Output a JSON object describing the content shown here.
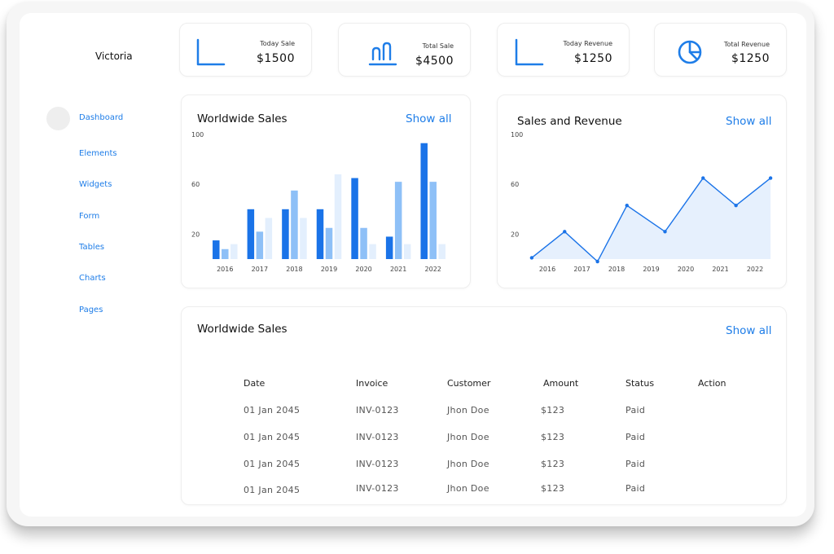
{
  "sidebar": {
    "brand": "Victoria",
    "items": [
      {
        "label": "Dashboard"
      },
      {
        "label": "Elements"
      },
      {
        "label": "Widgets"
      },
      {
        "label": "Form"
      },
      {
        "label": "Tables"
      },
      {
        "label": "Charts"
      },
      {
        "label": "Pages"
      }
    ]
  },
  "stats": [
    {
      "label": "Today Sale",
      "value": "$1500",
      "icon": "line-chart-icon"
    },
    {
      "label": "Total Sale",
      "value": "$4500",
      "icon": "bar-chart-icon"
    },
    {
      "label": "Today Revenue",
      "value": "$1250",
      "icon": "area-chart-icon"
    },
    {
      "label": "Total Revenue",
      "value": "$1250",
      "icon": "pie-chart-icon"
    }
  ],
  "worldwide_sales_chart": {
    "title": "Worldwide Sales",
    "show_all": "Show all"
  },
  "sales_revenue_chart": {
    "title": "Sales and Revenue",
    "show_all": "Show all"
  },
  "sales_table": {
    "title": "Worldwide Sales",
    "show_all": "Show all",
    "columns": [
      "Date",
      "Invoice",
      "Customer",
      "Amount",
      "Status",
      "Action"
    ],
    "rows": [
      {
        "date": "01 Jan 2045",
        "invoice": "INV-0123",
        "customer": "Jhon Doe",
        "amount": "$123",
        "status": "Paid"
      },
      {
        "date": "01 Jan 2045",
        "invoice": "INV-0123",
        "customer": "Jhon Doe",
        "amount": "$123",
        "status": "Paid"
      },
      {
        "date": "01 Jan 2045",
        "invoice": "INV-0123",
        "customer": "Jhon Doe",
        "amount": "$123",
        "status": "Paid"
      },
      {
        "date": "01 Jan 2045",
        "invoice": "INV-0123",
        "customer": "Jhon Doe",
        "amount": "$123",
        "status": "Paid"
      }
    ]
  },
  "colors": {
    "accent": "#1e7de8",
    "bar_dark": "#1a73e8",
    "bar_mid": "#8ec0f7",
    "bar_light": "#e3effd",
    "area_fill": "#e6f0fd"
  },
  "chart_data": [
    {
      "type": "bar",
      "title": "Worldwide Sales",
      "categories": [
        "2016",
        "2017",
        "2018",
        "2019",
        "2020",
        "2021",
        "2022"
      ],
      "y_ticks": [
        20,
        60,
        100
      ],
      "ylim": [
        0,
        100
      ],
      "grid": false,
      "series": [
        {
          "values": [
            15,
            40,
            40,
            40,
            65,
            18,
            93
          ]
        },
        {
          "values": [
            8,
            22,
            55,
            25,
            25,
            62,
            62
          ]
        },
        {
          "values": [
            12,
            33,
            33,
            68,
            12,
            12,
            12
          ]
        }
      ]
    },
    {
      "type": "area",
      "title": "Sales and Revenue",
      "x": [
        "2016",
        "2017",
        "2018",
        "2019",
        "2020",
        "2021",
        "2022"
      ],
      "points_x": [
        2015.55,
        2016.5,
        2017.45,
        2018.3,
        2019.4,
        2020.5,
        2021.45,
        2022.45
      ],
      "points_y": [
        1,
        22,
        -2,
        43,
        22,
        65,
        43,
        65
      ],
      "y_ticks": [
        20,
        60,
        100
      ],
      "ylim": [
        0,
        100
      ],
      "grid": false
    }
  ]
}
